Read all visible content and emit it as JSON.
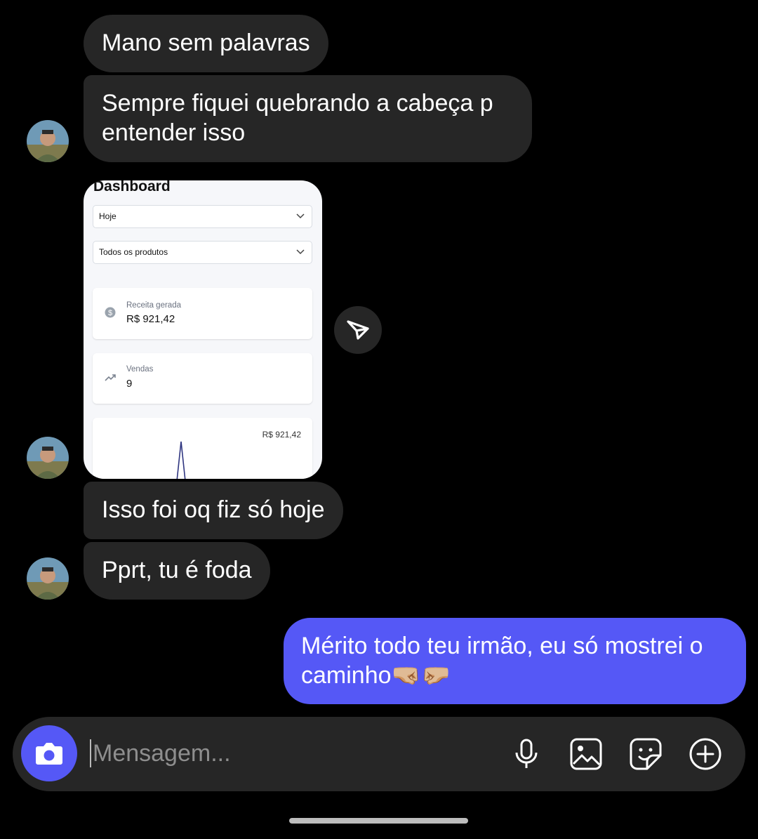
{
  "messages": [
    {
      "text": "Mano sem palavras"
    },
    {
      "text": "Sempre fiquei quebrando a cabeça p entender isso"
    },
    {
      "text": "Isso foi oq fiz só hoje"
    },
    {
      "text": "Pprt, tu é foda"
    }
  ],
  "shared_screenshot": {
    "title": "Dashboard",
    "select_period": "Hoje",
    "select_products": "Todos os produtos",
    "card_revenue_label": "Receita gerada",
    "card_revenue_value": "R$ 921,42",
    "card_sales_label": "Vendas",
    "card_sales_value": "9",
    "chart_label": "R$ 921,42"
  },
  "my_message": {
    "text": "Mérito todo teu irmão, eu só mostrei o caminho",
    "emoji": "🤜🏼🤛🏼"
  },
  "composer": {
    "placeholder": "Mensagem..."
  },
  "icons": [
    "avatar",
    "send-icon",
    "camera-icon",
    "microphone-icon",
    "gallery-icon",
    "sticker-icon",
    "plus-icon"
  ],
  "colors": {
    "background": "#000000",
    "incoming_bubble": "#262626",
    "outgoing_bubble": "#5558f6"
  }
}
